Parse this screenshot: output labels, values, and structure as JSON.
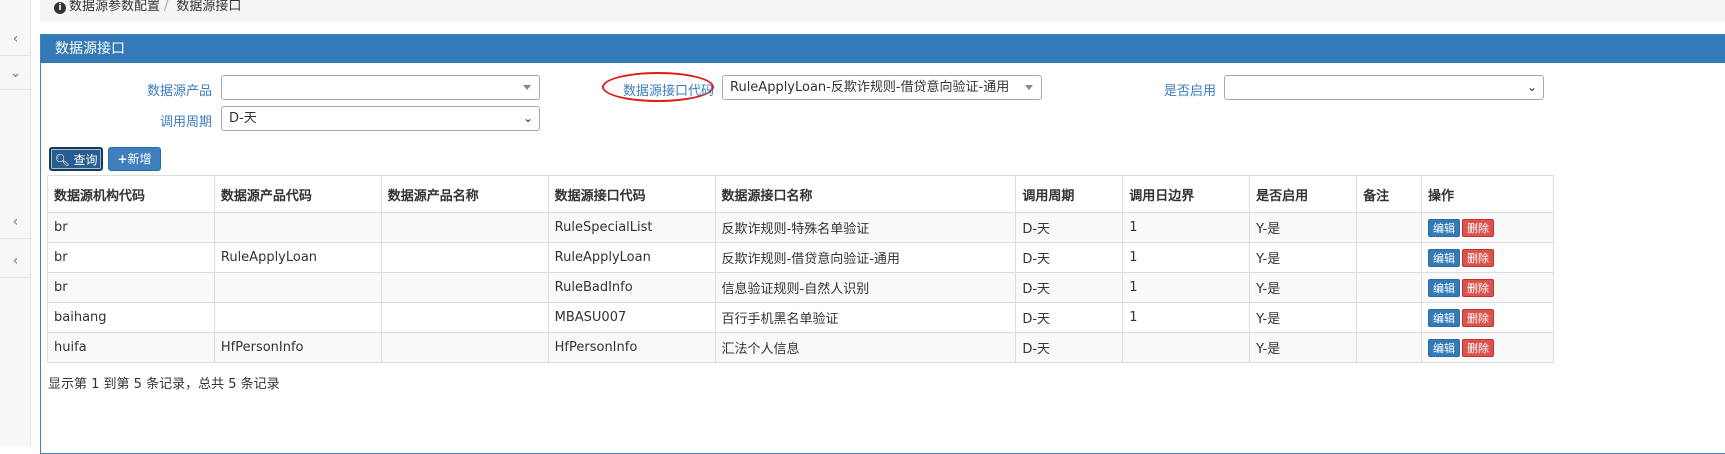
{
  "breadcrumb": {
    "items": [
      "数据源参数配置",
      "数据源接口"
    ]
  },
  "panel": {
    "title": "数据源接口"
  },
  "filters": {
    "product_label": "数据源产品",
    "product_value": "",
    "interface_code_label": "数据源接口代码",
    "interface_code_value": "RuleApplyLoan-反欺诈规则-借贷意向验证-通用",
    "enabled_label": "是否启用",
    "enabled_value": "",
    "cycle_label": "调用周期",
    "cycle_value": "D-天"
  },
  "buttons": {
    "query": "查询",
    "add": "新增"
  },
  "table": {
    "columns": [
      "数据源机构代码",
      "数据源产品代码",
      "数据源产品名称",
      "数据源接口代码",
      "数据源接口名称",
      "调用周期",
      "调用日边界",
      "是否启用",
      "备注",
      "操作"
    ],
    "edit_label": "编辑",
    "delete_label": "删除",
    "rows": [
      [
        "br",
        "",
        "",
        "RuleSpecialList",
        "反欺诈规则-特殊名单验证",
        "D-天",
        "1",
        "Y-是",
        ""
      ],
      [
        "br",
        "RuleApplyLoan",
        "",
        "RuleApplyLoan",
        "反欺诈规则-借贷意向验证-通用",
        "D-天",
        "1",
        "Y-是",
        ""
      ],
      [
        "br",
        "",
        "",
        "RuleBadInfo",
        "信息验证规则-自然人识别",
        "D-天",
        "1",
        "Y-是",
        ""
      ],
      [
        "baihang",
        "",
        "",
        "MBASU007",
        "百行手机黑名单验证",
        "D-天",
        "1",
        "Y-是",
        ""
      ],
      [
        "huifa",
        "HfPersonInfo",
        "",
        "HfPersonInfo",
        "汇法个人信息",
        "D-天",
        "",
        "Y-是",
        ""
      ]
    ]
  },
  "pagination": {
    "summary": "显示第 1 到第 5 条记录，总共 5 条记录"
  },
  "icons": {
    "rail": [
      "chevron-left-icon",
      "chevron-down-icon",
      "chevron-left-icon",
      "chevron-left-icon"
    ]
  },
  "colors": {
    "accent": "#337ab7",
    "danger": "#d9534f",
    "annotation": "#e01b1b"
  }
}
